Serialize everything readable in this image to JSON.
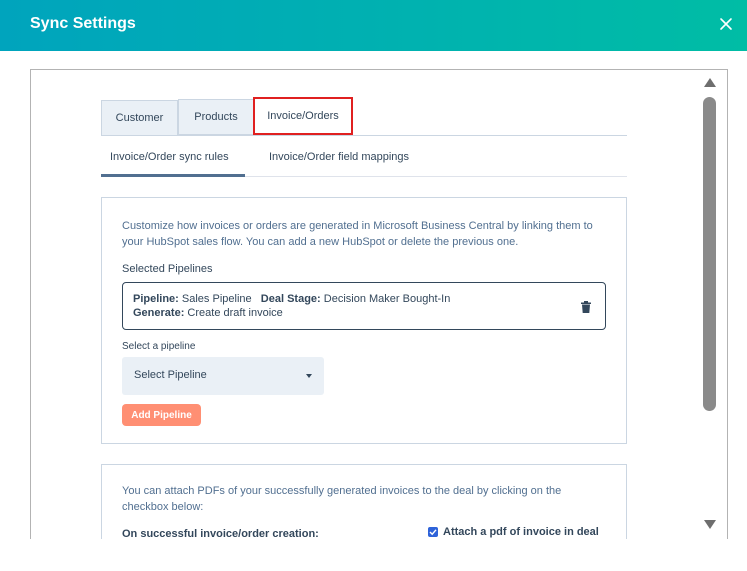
{
  "header": {
    "title": "Sync Settings",
    "close_icon": "close-icon"
  },
  "tabs": [
    {
      "label": "Customer"
    },
    {
      "label": "Products"
    },
    {
      "label": "Invoice/Orders"
    }
  ],
  "subtabs": [
    {
      "label": "Invoice/Order sync rules"
    },
    {
      "label": "Invoice/Order field mappings"
    }
  ],
  "rules": {
    "description": "Customize how invoices or orders are generated in Microsoft Business Central by linking them to your HubSpot sales flow. You can add a new HubSpot or delete the previous one.",
    "selected_label": "Selected Pipelines",
    "pipeline_card": {
      "pipeline_key": "Pipeline:",
      "pipeline_value": "Sales Pipeline",
      "stage_key": "Deal Stage:",
      "stage_value": "Decision Maker Bought-In",
      "generate_key": "Generate:",
      "generate_value": "Create draft invoice"
    },
    "select_label": "Select a pipeline",
    "select_value": "Select Pipeline",
    "add_button": "Add Pipeline"
  },
  "pdf": {
    "description": "You can attach PDFs of your successfully generated invoices to the deal by clicking on the checkbox below:",
    "on_success_label": "On successful invoice/order creation:",
    "attach_label": "Attach a pdf of invoice in deal",
    "attach_checked": true
  },
  "colors": {
    "header_gradient_start": "#00a4bd",
    "header_gradient_end": "#00bda5",
    "active_tab_border": "#e02020",
    "add_button": "#ff8f73",
    "checkbox": "#2e63d9"
  }
}
